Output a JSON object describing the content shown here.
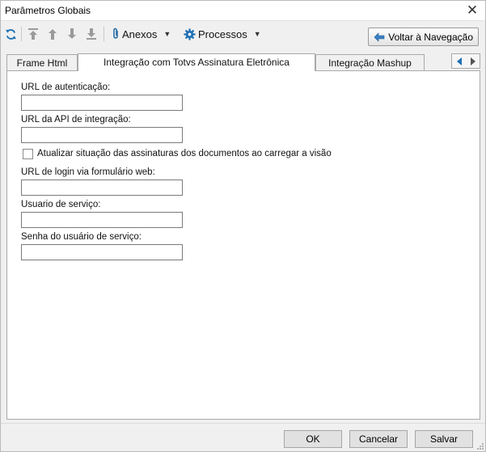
{
  "window": {
    "title": "Parâmetros Globais"
  },
  "toolbar": {
    "icons": [
      "refresh-icon",
      "move-top-icon",
      "move-up-icon",
      "move-down-icon",
      "move-bottom-icon"
    ],
    "anexos_label": "Anexos",
    "processos_label": "Processos",
    "voltar_label": "Voltar à Navegação"
  },
  "tabs": [
    {
      "label": "Frame Html",
      "active": false
    },
    {
      "label": "Integração com Totvs Assinatura Eletrônica",
      "active": true
    },
    {
      "label": "Integração Mashup",
      "active": false
    }
  ],
  "form": {
    "url_autenticacao_label": "URL de autenticação:",
    "url_autenticacao_value": "",
    "url_api_label": "URL da API de integração:",
    "url_api_value": "",
    "atualizar_checkbox_label": "Atualizar situação das assinaturas dos documentos ao carregar a visão",
    "atualizar_checked": false,
    "url_login_label": "URL de login via formulário web:",
    "url_login_value": "",
    "usuario_label": "Usuario de serviço:",
    "usuario_value": "",
    "senha_label": "Senha do usuário de serviço:",
    "senha_value": ""
  },
  "footer": {
    "ok_label": "OK",
    "cancelar_label": "Cancelar",
    "salvar_label": "Salvar"
  },
  "colors": {
    "accent_blue": "#1f6fb2",
    "icon_gray": "#9a9a9a",
    "panel_bg": "#ffffff",
    "window_bg": "#f0f0f0"
  }
}
